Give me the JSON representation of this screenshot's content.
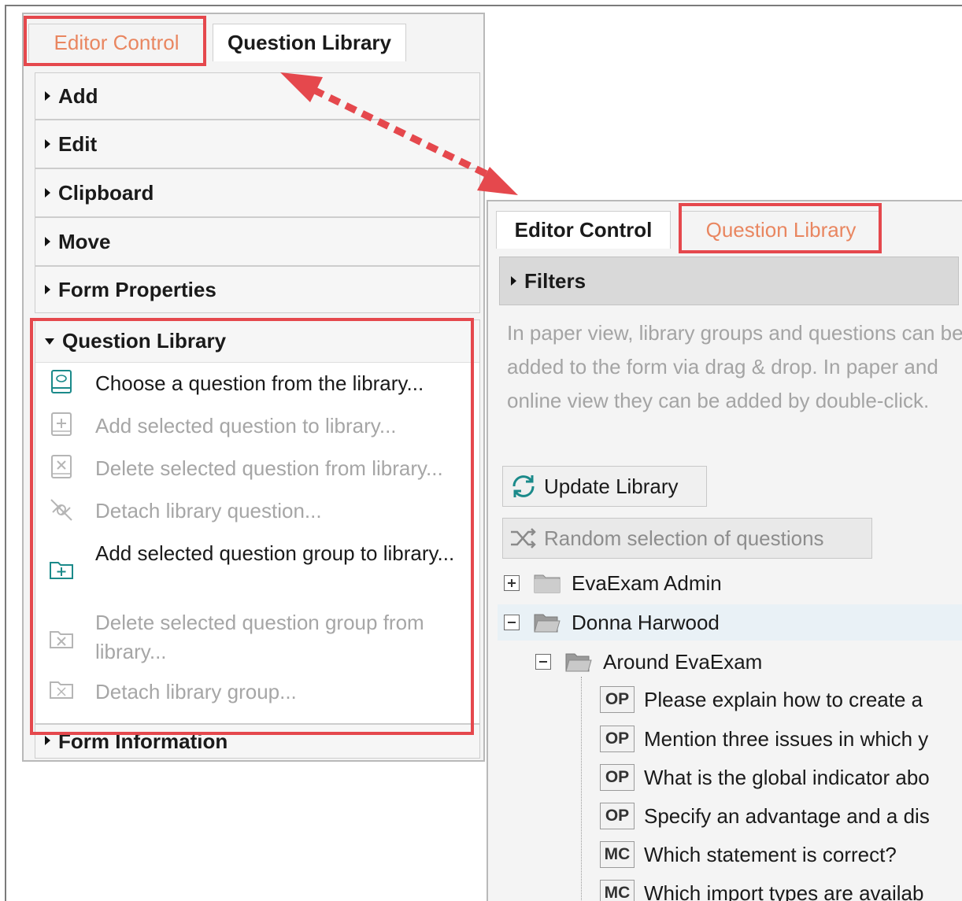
{
  "left_panel": {
    "tabs": {
      "editor_control": "Editor Control",
      "question_library": "Question Library"
    },
    "sections": [
      "Add",
      "Edit",
      "Clipboard",
      "Move",
      "Form Properties"
    ],
    "question_library": {
      "title": "Question Library",
      "items": [
        {
          "label": "Choose a question from the library...",
          "enabled": true,
          "icon": "book-icon"
        },
        {
          "label": "Add selected question to library...",
          "enabled": false,
          "icon": "add-doc-icon"
        },
        {
          "label": "Delete selected question from library...",
          "enabled": false,
          "icon": "delete-doc-icon"
        },
        {
          "label": "Detach library question...",
          "enabled": false,
          "icon": "unlink-icon"
        },
        {
          "label": "Add selected question group to library...",
          "enabled": true,
          "icon": "add-folder-icon"
        },
        {
          "label": "Delete selected question group from library...",
          "enabled": false,
          "icon": "delete-folder-icon"
        },
        {
          "label": "Detach library group...",
          "enabled": false,
          "icon": "detach-folder-icon"
        }
      ]
    },
    "form_information": "Form Information"
  },
  "right_panel": {
    "tabs": {
      "editor_control": "Editor Control",
      "question_library": "Question Library"
    },
    "filters": "Filters",
    "info_text": "In paper view, library groups and questions can be added to the form via drag & drop. In paper and online view they can be added by double-click.",
    "update_button": "Update Library",
    "random_button": "Random selection of questions",
    "tree": {
      "groups": [
        {
          "name": "EvaExam Admin",
          "expanded": false
        },
        {
          "name": "Donna Harwood",
          "expanded": true
        },
        {
          "name": "Around EvaExam",
          "expanded": true
        }
      ],
      "questions": [
        {
          "type": "OP",
          "text": "Please explain how to create a"
        },
        {
          "type": "OP",
          "text": "Mention three issues in which y"
        },
        {
          "type": "OP",
          "text": "What is the global indicator abo"
        },
        {
          "type": "OP",
          "text": "Specify an advantage and a dis"
        },
        {
          "type": "MC",
          "text": "Which statement is correct?"
        },
        {
          "type": "MC",
          "text": "Which import types are availab"
        }
      ]
    }
  },
  "colors": {
    "highlight": "#e5484d",
    "active_tab_text": "#e98660",
    "disabled_text": "#a6a6a6"
  }
}
